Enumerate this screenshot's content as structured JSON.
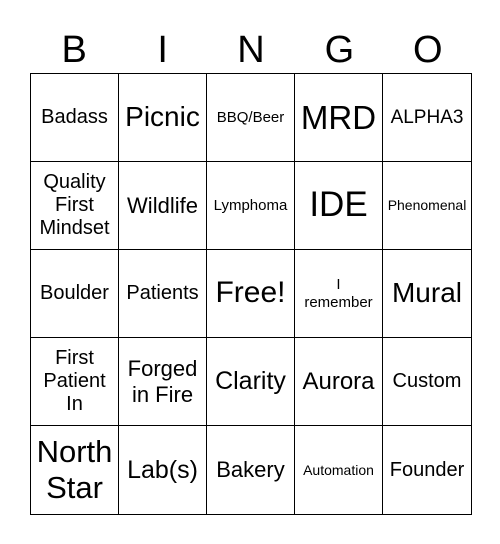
{
  "header": {
    "letters": [
      "B",
      "I",
      "N",
      "G",
      "O"
    ]
  },
  "cells": [
    "Badass",
    "Picnic",
    "BBQ/Beer",
    "MRD",
    "ALPHA3",
    "Quality First Mindset",
    "Wildlife",
    "Lymphoma",
    "IDE",
    "Phenomenal",
    "Boulder",
    "Patients",
    "Free!",
    "I remember",
    "Mural",
    "First Patient In",
    "Forged in Fire",
    "Clarity",
    "Aurora",
    "Custom",
    "North Star",
    "Lab(s)",
    "Bakery",
    "Automation",
    "Founder"
  ]
}
